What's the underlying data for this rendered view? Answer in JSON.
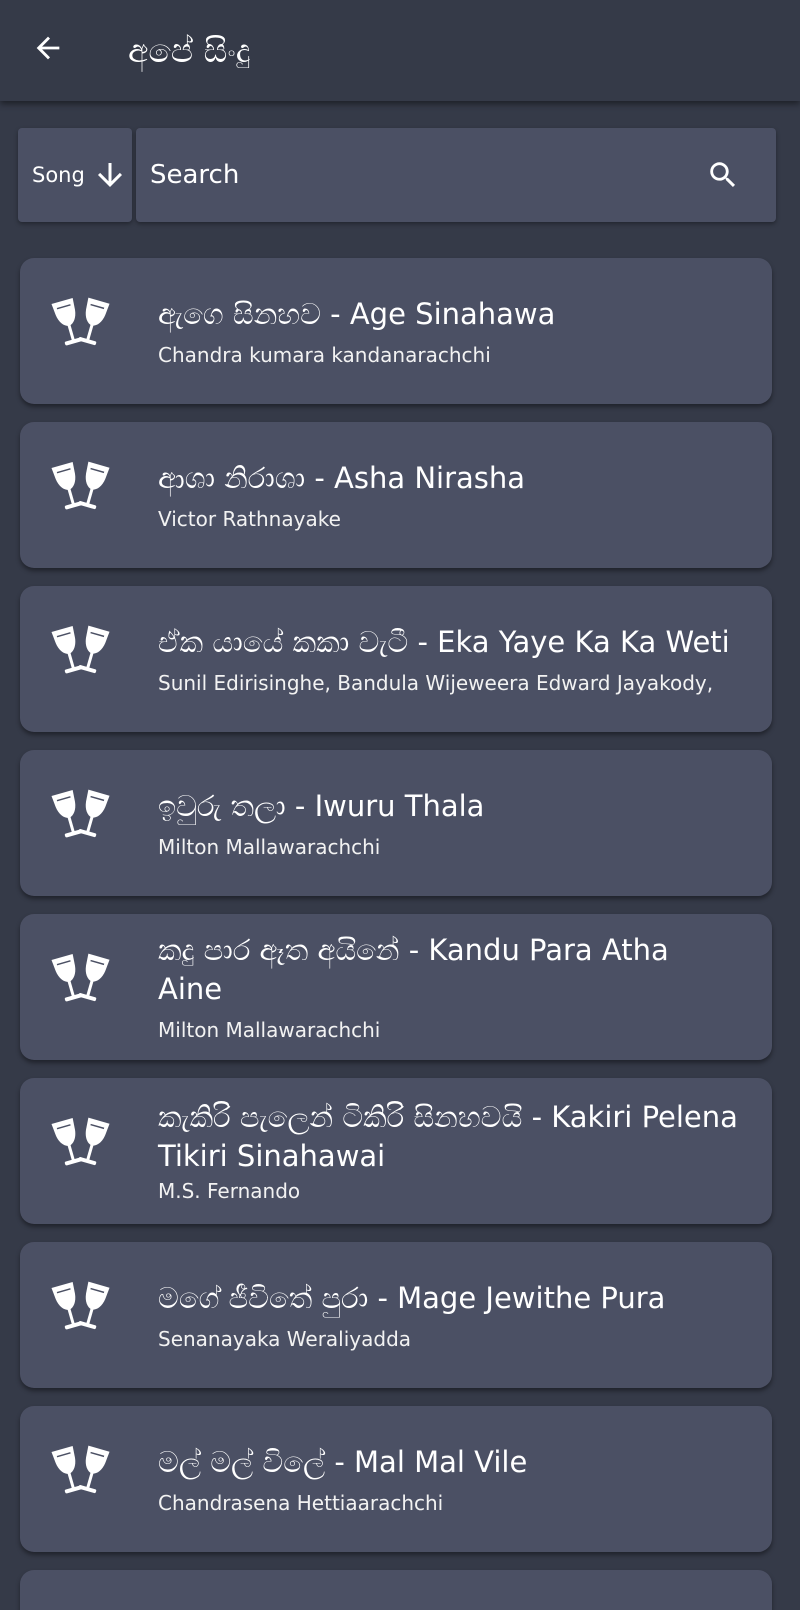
{
  "app_bar": {
    "title": "අපේ සිංදු",
    "back_icon": "arrow-left-icon"
  },
  "search": {
    "sort_label": "Song",
    "sort_icon": "arrow-down-icon",
    "placeholder": "Search",
    "search_icon": "search-icon"
  },
  "colors": {
    "background": "#353a48",
    "card": "#4b5064",
    "text": "#ffffff"
  },
  "songs": [
    {
      "title": "ඇගෙ සිනහව - Age Sinahawa",
      "artist": "Chandra kumara kandanarachchi",
      "icon": "clinking-glasses-icon"
    },
    {
      "title": "ආශා නිරාශා - Asha Nirasha",
      "artist": "Victor Rathnayake",
      "icon": "clinking-glasses-icon"
    },
    {
      "title": "ඒක යායේ කකා වැටී - Eka Yaye Ka Ka Weti",
      "artist": "Sunil Edirisinghe, Bandula Wijeweera Edward Jayakody,",
      "icon": "clinking-glasses-icon"
    },
    {
      "title": "ඉවුරු තලා - Iwuru Thala",
      "artist": "Milton Mallawarachchi",
      "icon": "clinking-glasses-icon"
    },
    {
      "title": "කදු පාර ඈත අයිනේ - Kandu Para Atha Aine",
      "artist": "Milton Mallawarachchi",
      "icon": "clinking-glasses-icon"
    },
    {
      "title": "කැකිරි පැලෙන් ටිකිරි සිනහවයි - Kakiri Pelena Tikiri Sinahawai",
      "artist": "M.S. Fernando",
      "icon": "clinking-glasses-icon"
    },
    {
      "title": "මගේ ජීවිතේ පුරා - Mage Jewithe Pura",
      "artist": "Senanayaka Weraliyadda",
      "icon": "clinking-glasses-icon"
    },
    {
      "title": "මල් මල් විලේ - Mal Mal Vile",
      "artist": "Chandrasena Hettiaarachchi",
      "icon": "clinking-glasses-icon"
    }
  ]
}
